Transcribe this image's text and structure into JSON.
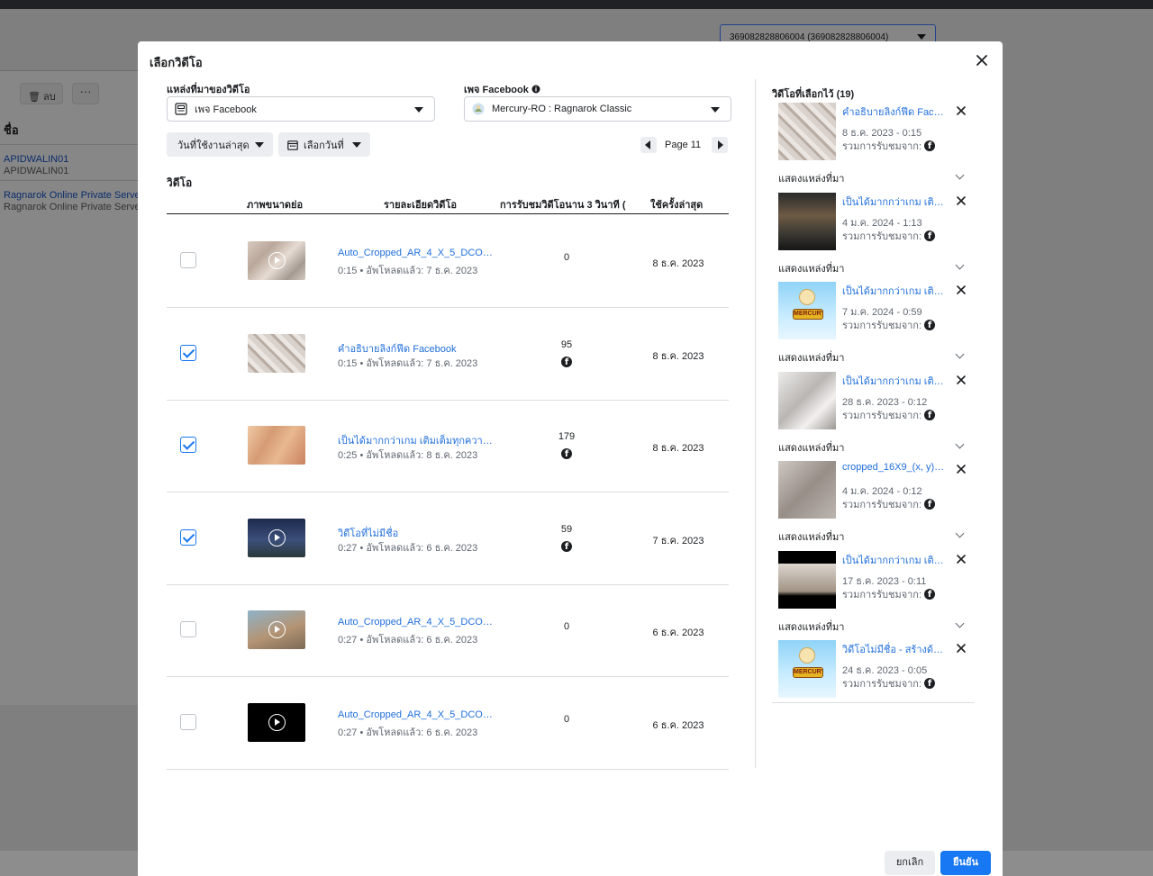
{
  "background": {
    "account_selector": "369082828806004 (369082828806004)",
    "delete_label": "ลบ",
    "more_label": "···",
    "name_col": "ชื่อ",
    "rows": [
      {
        "line1": "APIDWALIN01",
        "line2": "APIDWALIN01"
      },
      {
        "line1": "Ragnarok Online Private Server",
        "line2": "Ragnarok Online Private Server"
      }
    ]
  },
  "modal": {
    "title": "เลือกวิดีโอ",
    "source_label": "แหล่งที่มาของวิดีโอ",
    "source_value": "เพจ Facebook",
    "page_label": "เพจ Facebook",
    "page_value": "Mercury-RO : Ragnarok Classic",
    "sort_chip": "วันที่ใช้งานล่าสุด",
    "date_chip": "เลือกวันที่",
    "page_indicator": "Page 11",
    "section_title": "วิดีโอ",
    "columns": {
      "thumb": "ภาพขนาดย่อ",
      "details": "รายละเอียดวิดีโอ",
      "views": "การรับชมวิดีโอนาน 3 วินาที (",
      "last_used": "ใช้ครั้งล่าสุด"
    },
    "videos": [
      {
        "title": "Auto_Cropped_AR_4_X_5_DCO_V...",
        "meta": "0:15 • อัพโหลดแล้ว: 7 ธ.ค. 2023",
        "views": "0",
        "last_used": "8 ธ.ค. 2023",
        "checked": false,
        "thumb": "t-map",
        "has_play": true,
        "fb_icon": false
      },
      {
        "title": "คำอธิบายลิงก์ฟีด Facebook",
        "meta": "0:15 • อัพโหลดแล้ว: 7 ธ.ค. 2023",
        "views": "95",
        "last_used": "8 ธ.ค. 2023",
        "checked": true,
        "thumb": "t-map2",
        "has_play": false,
        "fb_icon": true
      },
      {
        "title": "เป็นได้มากกว่าเกม เติมเต็มทุกความรู้...",
        "meta": "0:25 • อัพโหลดแล้ว: 8 ธ.ค. 2023",
        "views": "179",
        "last_used": "8 ธ.ค. 2023",
        "checked": true,
        "thumb": "t-fest",
        "has_play": false,
        "fb_icon": true
      },
      {
        "title": "วิดีโอที่ไม่มีชื่อ",
        "meta": "0:27 • อัพโหลดแล้ว: 6 ธ.ค. 2023",
        "views": "59",
        "last_used": "7 ธ.ค. 2023",
        "checked": true,
        "thumb": "t-night",
        "has_play": true,
        "fb_icon": true
      },
      {
        "title": "Auto_Cropped_AR_4_X_5_DCO_3...",
        "meta": "0:27 • อัพโหลดแล้ว: 6 ธ.ค. 2023",
        "views": "0",
        "last_used": "6 ธ.ค. 2023",
        "checked": false,
        "thumb": "t-field",
        "has_play": true,
        "fb_icon": false
      },
      {
        "title": "Auto_Cropped_AR_4_X_5_DCO_V...",
        "meta": "0:27 • อัพโหลดแล้ว: 6 ธ.ค. 2023",
        "views": "0",
        "last_used": "6 ธ.ค. 2023",
        "checked": false,
        "thumb": "t-black",
        "has_play": true,
        "fb_icon": false
      }
    ],
    "selected_title": "วิดีโอที่เลือกไว้ (19)",
    "selected": [
      {
        "title": "คำอธิบายลิงก์ฟีด Facebook",
        "date": "8 ธ.ค. 2023 - 0:15",
        "reach": "รวมการรับชมจาก:",
        "source": "แสดงแหล่งที่มา",
        "thumb": "t-map2",
        "chibi": false
      },
      {
        "title": "เป็นได้มากกว่าเกม เติมเต็มทุกความรู้",
        "date": "4 ม.ค. 2024 - 1:13",
        "reach": "รวมการรับชมจาก:",
        "source": "แสดงแหล่งที่มา",
        "thumb": "t-dark",
        "chibi": false
      },
      {
        "title": "เป็นได้มากกว่าเกม เติมเต็มทุกความรู้",
        "date": "7 ม.ค. 2024 - 0:59",
        "reach": "รวมการรับชมจาก:",
        "source": "แสดงแหล่งที่มา",
        "thumb": "t-chibi",
        "chibi": true
      },
      {
        "title": "เป็นได้มากกว่าเกม เติมเต็มทุกความรู้",
        "date": "28 ธ.ค. 2023 - 0:12",
        "reach": "รวมการรับชมจาก:",
        "source": "แสดงแหล่งที่มา",
        "thumb": "t-grey",
        "chibi": false
      },
      {
        "title": "cropped_16X9_(x, y)_...",
        "date": "4 ม.ค. 2024 - 0:12",
        "reach": "รวมการรับชมจาก:",
        "source": "แสดงแหล่งที่มา",
        "thumb": "t-floor",
        "chibi": false
      },
      {
        "title": "เป็นได้มากกว่าเกม เติมเต็มทุกความรู้",
        "date": "17 ธ.ค. 2023 - 0:11",
        "reach": "รวมการรับชมจาก:",
        "source": "แสดงแหล่งที่มา",
        "thumb": "t-troop",
        "chibi": false
      },
      {
        "title": "วิดีโอไม่มีชื่อ - สร้างด้วย...",
        "date": "24 ธ.ค. 2023 - 0:05",
        "reach": "รวมการรับชมจาก:",
        "source": "",
        "thumb": "t-chibi",
        "chibi": true
      }
    ],
    "chibi_text": "MERCURY",
    "cancel_label": "ยกเลิก",
    "confirm_label": "ยืนยัน"
  },
  "colors": {
    "accent": "#1877f2",
    "link": "#216fdb",
    "muted": "#606770"
  }
}
